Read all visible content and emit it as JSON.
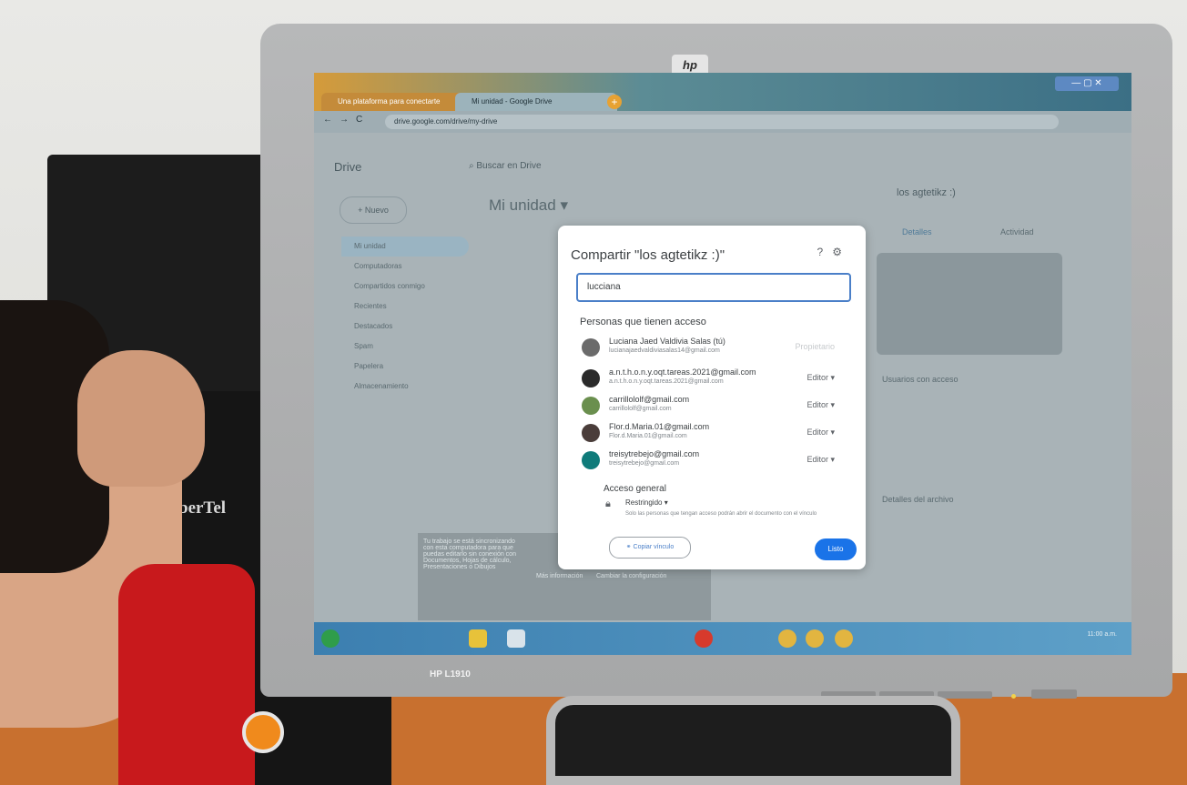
{
  "scene": {
    "monitor_logo": "hp",
    "monitor_model": "HP L1910",
    "speaker_brand": "berTel"
  },
  "browser": {
    "tabs": [
      {
        "label": "Una plataforma para conectarte"
      },
      {
        "label": "Mi unidad - Google Drive"
      }
    ],
    "new_tab_symbol": "+",
    "url": "drive.google.com/drive/my-drive"
  },
  "drive": {
    "logo_text": "Drive",
    "search_placeholder": "Buscar en Drive",
    "page_title": "Mi unidad",
    "new_button": "Nuevo",
    "sidebar": [
      "Mi unidad",
      "Computadoras",
      "Compartidos conmigo",
      "Recientes",
      "Destacados",
      "Spam",
      "Papelera",
      "Almacenamiento"
    ],
    "detail_title": "los agtetikz :)",
    "detail_tabs": [
      "Detalles",
      "Actividad"
    ],
    "detail_sections": [
      "Usuarios con acceso",
      "Detalles del archivo"
    ],
    "drawer_text": "Tu trabajo se está sincronizando con esta computadora para que puedas editarlo sin conexión con Documentos, Hojas de cálculo, Presentaciones o Dibujos",
    "drawer_links": [
      "Más información",
      "Cambiar la configuración"
    ]
  },
  "share_dialog": {
    "title": "Compartir \"los agtetikz :)\"",
    "input_value": "lucciana",
    "people_heading": "Personas que tienen acceso",
    "people": [
      {
        "name": "Luciana Jaed Valdivia Salas (tú)",
        "email": "lucianajaedvaldiviasalas14@gmail.com",
        "role": "Propietario"
      },
      {
        "name": "a.n.t.h.o.n.y.oqt.tareas.2021@gmail.com",
        "email": "a.n.t.h.o.n.y.oqt.tareas.2021@gmail.com",
        "role": "Editor"
      },
      {
        "name": "carrillololf@gmail.com",
        "email": "carrillololf@gmail.com",
        "role": "Editor"
      },
      {
        "name": "Flor.d.Maria.01@gmail.com",
        "email": "Flor.d.Maria.01@gmail.com",
        "role": "Editor"
      },
      {
        "name": "treisytrebejo@gmail.com",
        "email": "treisytrebejo@gmail.com",
        "role": "Editor"
      }
    ],
    "general_access_heading": "Acceso general",
    "restriction": "Restringido",
    "restriction_desc": "Solo las personas que tengan acceso podrán abrir el documento con el vínculo",
    "copy_link": "Copiar vínculo",
    "done": "Listo"
  },
  "colors": {
    "accent": "#1a73e8",
    "sleeve": "#c8191c",
    "desk": "#c8702f"
  }
}
